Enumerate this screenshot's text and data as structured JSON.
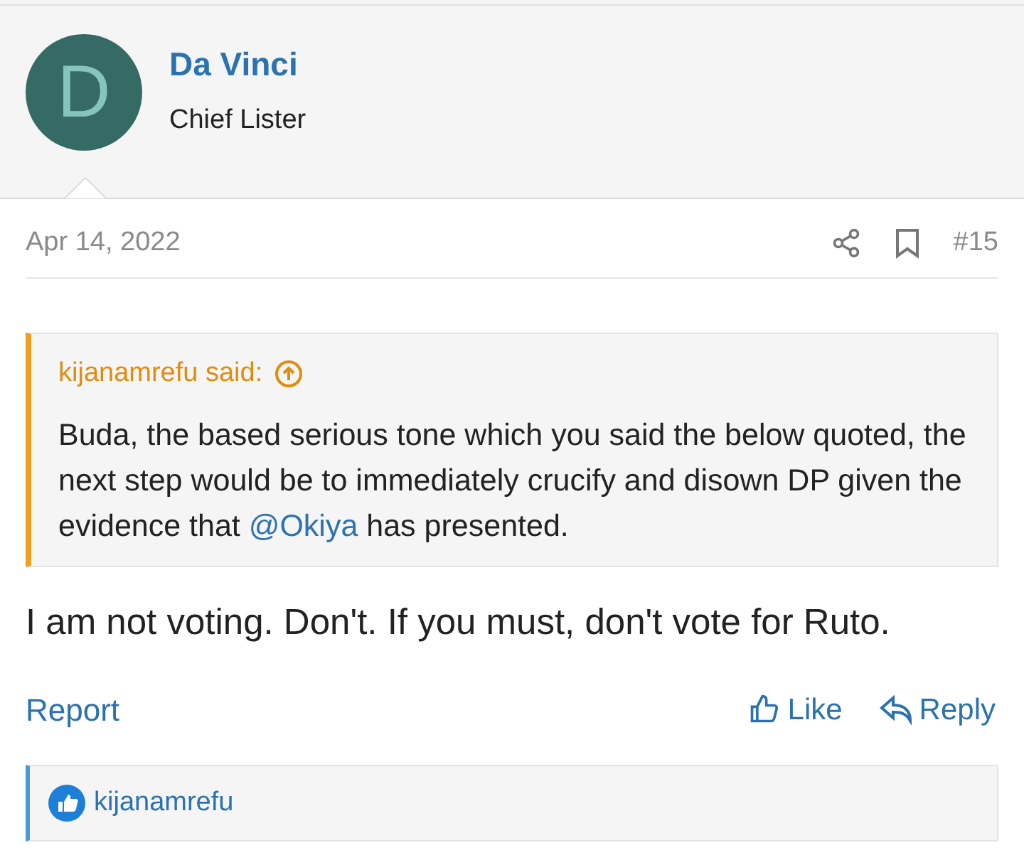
{
  "author": {
    "initial": "D",
    "name": "Da Vinci",
    "title": "Chief Lister"
  },
  "post": {
    "date": "Apr 14, 2022",
    "number": "#15"
  },
  "quote": {
    "attribution": "kijanamrefu said:",
    "text_before": "Buda, the based serious tone which you said the below quoted, the next step would be to immediately crucify and disown DP given the evidence that ",
    "mention": "@Okiya",
    "text_after": " has presented."
  },
  "message": "I am not voting. Don't. If you must, don't vote for Ruto.",
  "actions": {
    "report": "Report",
    "like": "Like",
    "reply": "Reply"
  },
  "reactions": {
    "users": "kijanamrefu"
  }
}
